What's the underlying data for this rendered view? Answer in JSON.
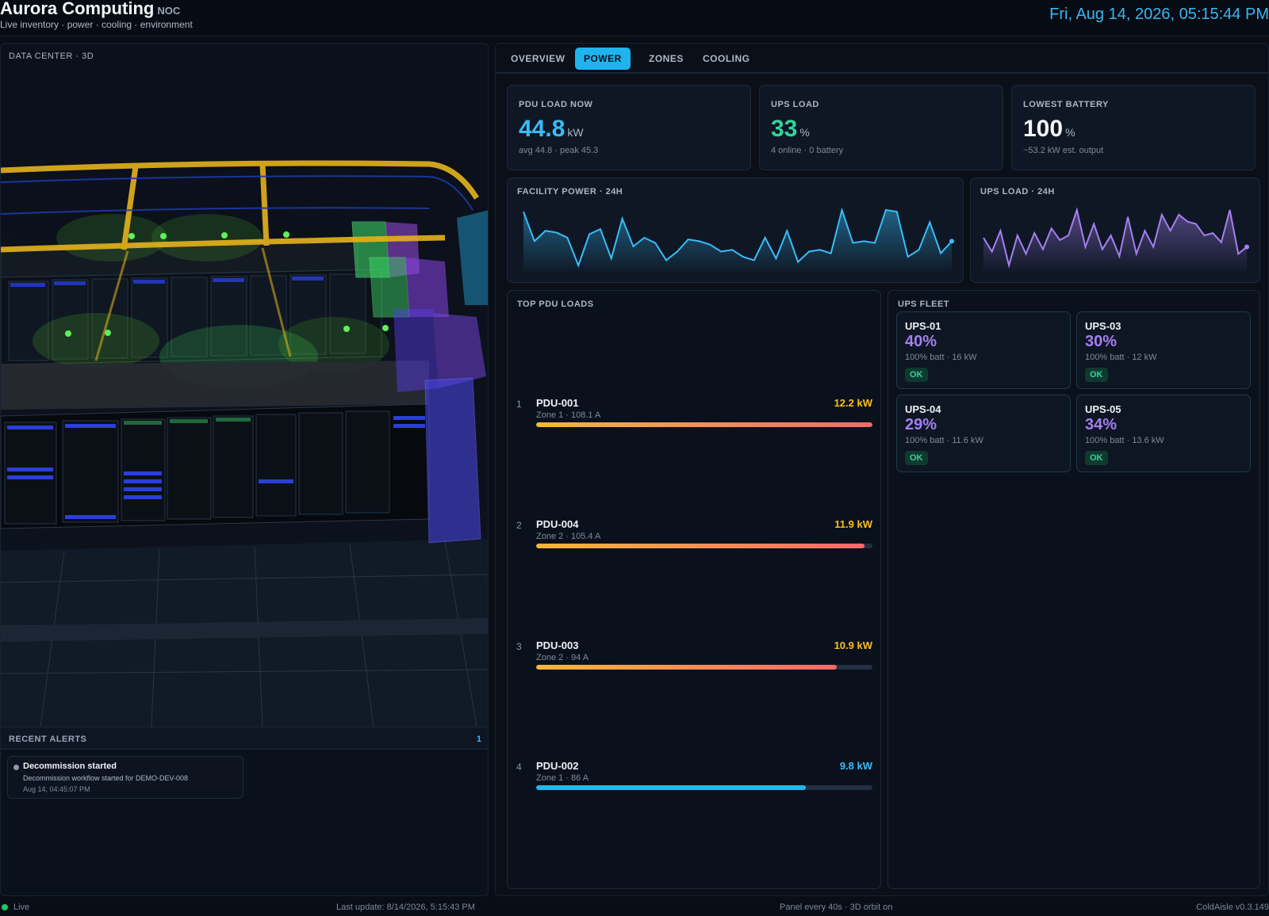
{
  "header": {
    "title": "Aurora Computing",
    "badge": "NOC",
    "subtitle": "Live inventory · power · cooling · environment",
    "clock": "Fri, Aug 14, 2026, 05:15:44 PM"
  },
  "viewport": {
    "label": "DATA CENTER · 3D"
  },
  "alerts": {
    "title": "RECENT ALERTS",
    "count": "1",
    "items": [
      {
        "title": "Decommission started",
        "message": "Decommission workflow started for DEMO-DEV-008",
        "time": "Aug 14, 04:45:07 PM"
      }
    ]
  },
  "tabs": [
    {
      "label": "OVERVIEW",
      "active": false
    },
    {
      "label": "POWER",
      "active": true
    },
    {
      "label": "ZONES",
      "active": false
    },
    {
      "label": "COOLING",
      "active": false
    }
  ],
  "kpis": [
    {
      "label": "PDU LOAD NOW",
      "value": "44.8",
      "unit": "kW",
      "sub": "avg 44.8 · peak 45.3",
      "color": "#38bdf8"
    },
    {
      "label": "UPS LOAD",
      "value": "33",
      "unit": "%",
      "sub": "4 online · 0 battery",
      "color": "#34d399"
    },
    {
      "label": "LOWEST BATTERY",
      "value": "100",
      "unit": "%",
      "sub": "~53.2 kW est. output",
      "color": "#f5f7fa"
    }
  ],
  "sparklines": {
    "facility": {
      "title": "FACILITY POWER · 24H",
      "color": "#38bdf8"
    },
    "ups": {
      "title": "UPS LOAD · 24H",
      "color": "#a57ff0"
    }
  },
  "chart_data": [
    {
      "type": "area",
      "title": "FACILITY POWER · 24H",
      "values": [
        44.2,
        42.5,
        43.1,
        43.0,
        42.7,
        41.1,
        42.9,
        43.2,
        41.5,
        43.8,
        42.2,
        42.7,
        42.4,
        41.4,
        41.9,
        42.6,
        42.5,
        42.3,
        41.9,
        42.0,
        41.6,
        41.4,
        42.7,
        41.5,
        43.1,
        41.3,
        41.9,
        42.0,
        41.8,
        44.3,
        42.4,
        42.5,
        42.4,
        44.3,
        44.2,
        41.6,
        42.0,
        43.6,
        41.8,
        42.5
      ]
    },
    {
      "type": "area",
      "title": "UPS LOAD · 24H",
      "values": [
        33.1,
        32.5,
        33.4,
        31.9,
        33.2,
        32.4,
        33.3,
        32.6,
        33.5,
        33.0,
        33.2,
        34.3,
        32.7,
        33.7,
        32.6,
        33.2,
        32.3,
        34.0,
        32.4,
        33.4,
        32.7,
        34.1,
        33.4,
        34.1,
        33.8,
        33.7,
        33.2,
        33.3,
        32.9,
        34.3,
        32.4,
        32.7
      ]
    }
  ],
  "pdu": {
    "title": "TOP PDU LOADS",
    "rows": [
      {
        "rank": "1",
        "name": "PDU-001",
        "meta": "Zone 1 · 108.1 A",
        "kw": "12.2 kW",
        "fill": 1.0,
        "color": "#fbbf24",
        "bar": "linear-gradient(90deg,#f6b63c,#f26a6a)"
      },
      {
        "rank": "2",
        "name": "PDU-004",
        "meta": "Zone 2 · 105.4 A",
        "kw": "11.9 kW",
        "fill": 0.976,
        "color": "#fbbf24",
        "bar": "linear-gradient(90deg,#f6b63c,#f26a6a)"
      },
      {
        "rank": "3",
        "name": "PDU-003",
        "meta": "Zone 2 · 94 A",
        "kw": "10.9 kW",
        "fill": 0.893,
        "color": "#fbbf24",
        "bar": "linear-gradient(90deg,#f6b63c,#f26a6a)"
      },
      {
        "rank": "4",
        "name": "PDU-002",
        "meta": "Zone 1 · 86 A",
        "kw": "9.8 kW",
        "fill": 0.803,
        "color": "#38bdf8",
        "bar": "#22b8ec"
      }
    ]
  },
  "ups": {
    "title": "UPS FLEET",
    "units": [
      {
        "name": "UPS-01",
        "pct": "40%",
        "meta": "100% batt · 16 kW",
        "status": "OK"
      },
      {
        "name": "UPS-03",
        "pct": "30%",
        "meta": "100% batt · 12 kW",
        "status": "OK"
      },
      {
        "name": "UPS-04",
        "pct": "29%",
        "meta": "100% batt · 11.6 kW",
        "status": "OK"
      },
      {
        "name": "UPS-05",
        "pct": "34%",
        "meta": "100% batt · 13.6 kW",
        "status": "OK"
      }
    ]
  },
  "footer": {
    "live": "Live",
    "last_update": "Last update: 8/14/2026, 5:15:43 PM",
    "refresh": "Panel every 40s · 3D orbit on",
    "version": "ColdAisle v0.3.149"
  }
}
